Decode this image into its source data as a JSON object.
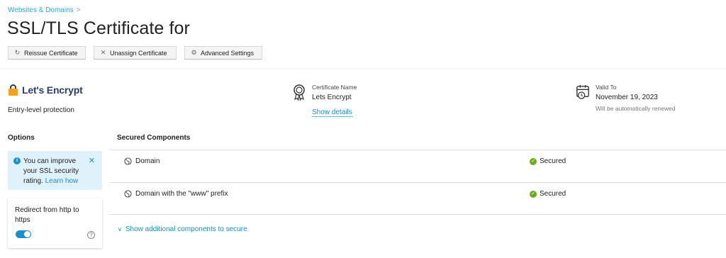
{
  "breadcrumb": {
    "item": "Websites & Domains",
    "separator": ">"
  },
  "page": {
    "title": "SSL/TLS Certificate for"
  },
  "toolbar": {
    "reissue_label": "Reissue Certificate",
    "unassign_label": "Unassign Certificate",
    "advanced_label": "Advanced Settings"
  },
  "provider": {
    "name": "Let's Encrypt",
    "subtitle": "Entry-level protection"
  },
  "certificate": {
    "label": "Certificate Name",
    "value": "Lets Encrypt",
    "link": "Show details"
  },
  "valid": {
    "label": "Valid To",
    "value": "November 19, 2023",
    "note": "Will be automatically renewed"
  },
  "options": {
    "heading": "Options",
    "info_text": "You can improve your SSL security rating.",
    "info_link": "Learn how",
    "redirect_label": "Redirect from http to https",
    "redirect_enabled": true
  },
  "components": {
    "heading": "Secured Components",
    "rows": [
      {
        "name": "Domain",
        "status": "Secured"
      },
      {
        "name": "Domain with the \"www\" prefix",
        "status": "Secured"
      }
    ],
    "show_more": "Show additional components to secure"
  },
  "colors": {
    "link": "#1b8fc6",
    "secured": "#6bab1d",
    "info_bg": "#dff2fc",
    "brand": "#2c3c69"
  }
}
